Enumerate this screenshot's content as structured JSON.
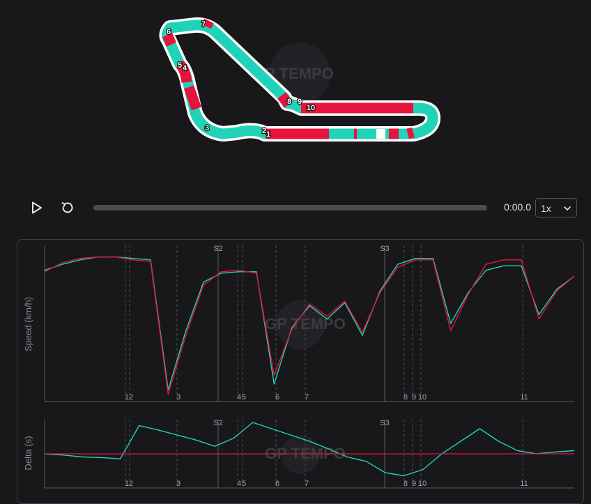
{
  "watermark": "GP TEMPO",
  "colors": {
    "teal": "#20d3b8",
    "red": "#e8133c",
    "background": "#18181b"
  },
  "track_map": {
    "turn_labels": [
      "1",
      "2",
      "3",
      "4",
      "5",
      "6",
      "7",
      "8",
      "9",
      "10"
    ]
  },
  "controls": {
    "play_icon": "play-icon",
    "reset_icon": "reset-icon",
    "time": "0:00.0",
    "playback_speed": "1x",
    "progress": 0
  },
  "chart_data": [
    {
      "type": "line",
      "ylabel": "Speed (km/h)",
      "sector_markers": [
        "S2",
        "S3"
      ],
      "corner_labels": [
        "1",
        "2",
        "3",
        "4",
        "5",
        "6",
        "7",
        "8",
        "9",
        "10",
        "11"
      ],
      "series": [
        {
          "color": "#20d3b8",
          "values": [
            0.86,
            0.9,
            0.93,
            0.95,
            0.95,
            0.94,
            0.93,
            0.05,
            0.45,
            0.78,
            0.84,
            0.85,
            0.85,
            0.09,
            0.47,
            0.62,
            0.53,
            0.64,
            0.42,
            0.72,
            0.9,
            0.94,
            0.94,
            0.5,
            0.71,
            0.86,
            0.89,
            0.89,
            0.56,
            0.73,
            0.82
          ]
        },
        {
          "color": "#e8133c",
          "values": [
            0.85,
            0.91,
            0.94,
            0.95,
            0.95,
            0.93,
            0.92,
            0.02,
            0.42,
            0.76,
            0.85,
            0.86,
            0.84,
            0.15,
            0.46,
            0.63,
            0.55,
            0.65,
            0.44,
            0.71,
            0.88,
            0.93,
            0.93,
            0.45,
            0.7,
            0.9,
            0.93,
            0.93,
            0.53,
            0.72,
            0.82
          ]
        }
      ]
    },
    {
      "type": "line",
      "ylabel": "Delta (s)",
      "sector_markers": [
        "S2",
        "S3"
      ],
      "corner_labels": [
        "1",
        "2",
        "3",
        "4",
        "5",
        "6",
        "7",
        "8",
        "9",
        "10",
        "11"
      ],
      "zero_line": 0,
      "series": [
        {
          "color": "#20d3b8",
          "values": [
            0,
            -0.02,
            -0.05,
            -0.06,
            -0.08,
            0.45,
            0.38,
            0.3,
            0.22,
            0.12,
            0.25,
            0.5,
            0.4,
            0.3,
            0.2,
            0.08,
            -0.05,
            -0.12,
            -0.3,
            -0.35,
            -0.25,
            0,
            0.2,
            0.4,
            0.2,
            0.05,
            0,
            0.03,
            0.05
          ]
        }
      ]
    }
  ]
}
